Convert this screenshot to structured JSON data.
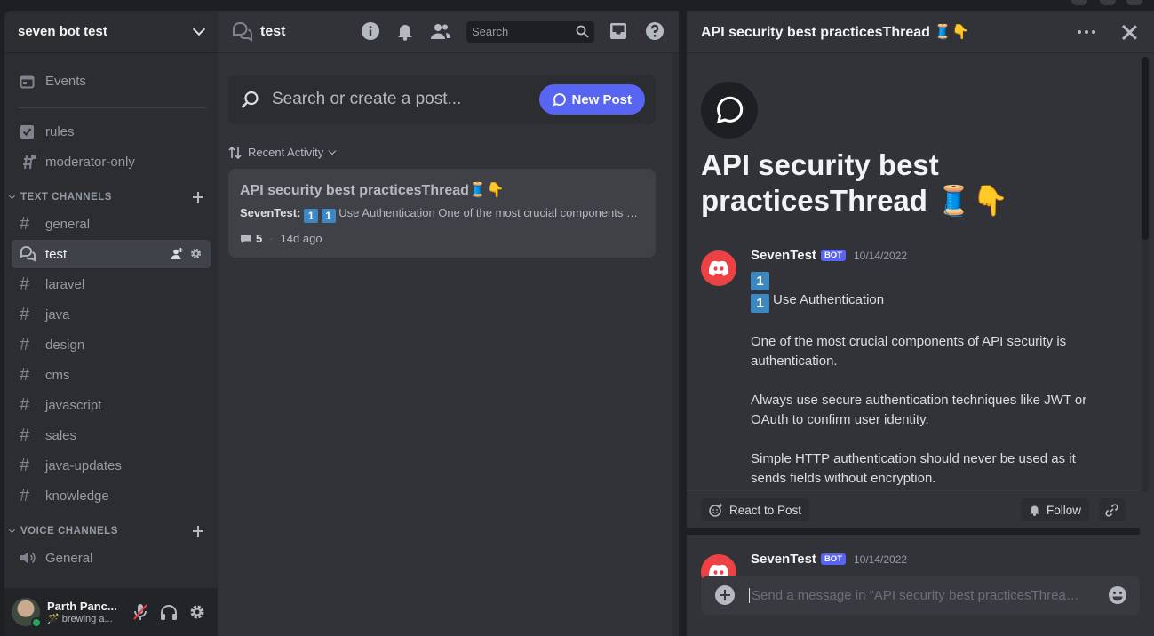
{
  "server": {
    "name": "seven bot test"
  },
  "sidebar": {
    "top_items": [
      {
        "label": "Events",
        "icon": "calendar-icon"
      },
      {
        "label": "rules",
        "icon": "rules-checkbox-icon"
      },
      {
        "label": "moderator-only",
        "icon": "locked-hash-icon"
      }
    ],
    "text_category": "TEXT CHANNELS",
    "text_channels": [
      {
        "label": "general",
        "icon": "hash-icon"
      },
      {
        "label": "test",
        "icon": "forum-icon",
        "active": true
      },
      {
        "label": "laravel",
        "icon": "hash-icon"
      },
      {
        "label": "java",
        "icon": "hash-icon"
      },
      {
        "label": "design",
        "icon": "hash-icon"
      },
      {
        "label": "cms",
        "icon": "hash-icon"
      },
      {
        "label": "javascript",
        "icon": "hash-icon"
      },
      {
        "label": "sales",
        "icon": "hash-icon"
      },
      {
        "label": "java-updates",
        "icon": "hash-icon"
      },
      {
        "label": "knowledge",
        "icon": "hash-icon"
      }
    ],
    "voice_category": "VOICE CHANNELS",
    "voice_channels": [
      {
        "label": "General",
        "icon": "speaker-icon"
      }
    ]
  },
  "user": {
    "name": "Parth Panc...",
    "status": "brewing a..."
  },
  "forum": {
    "channel_name": "test",
    "search_placeholder": "Search",
    "post_search_placeholder": "Search or create a post...",
    "new_post_label": "New Post",
    "sort_label": "Recent Activity",
    "post": {
      "title": "API security best practicesThread",
      "title_emoji": "🧵👇",
      "author": "SevenTest:",
      "keycaps": [
        "1",
        "1"
      ],
      "preview": "Use Authentication One of the most crucial components of API security is authentication.",
      "reply_count": "5",
      "age": "14d ago"
    }
  },
  "thread": {
    "header_title": "API security best practicesThread 🧵👇",
    "big_title": "API security best practicesThread 🧵👇",
    "message": {
      "author": "SevenTest",
      "badge": "BOT",
      "timestamp": "10/14/2022",
      "keycap": "1",
      "line_1": "Use Authentication",
      "para_1": "One of the most crucial components of API security is authentication.",
      "para_2": "Always use secure authentication techniques like JWT or OAuth to confirm user identity.",
      "para_3": "Simple HTTP authentication should never be used as it sends fields without encryption."
    },
    "react_label": "React to Post",
    "follow_label": "Follow",
    "reply": {
      "author": "SevenTest",
      "badge": "BOT",
      "timestamp": "10/14/2022"
    },
    "composer_placeholder": "Send a message in \"API security best practicesThread ..."
  },
  "colors": {
    "accent": "#5865f2",
    "bot_avatar": "#ed4245",
    "online": "#23a55a",
    "keycap": "#3b88c3"
  }
}
